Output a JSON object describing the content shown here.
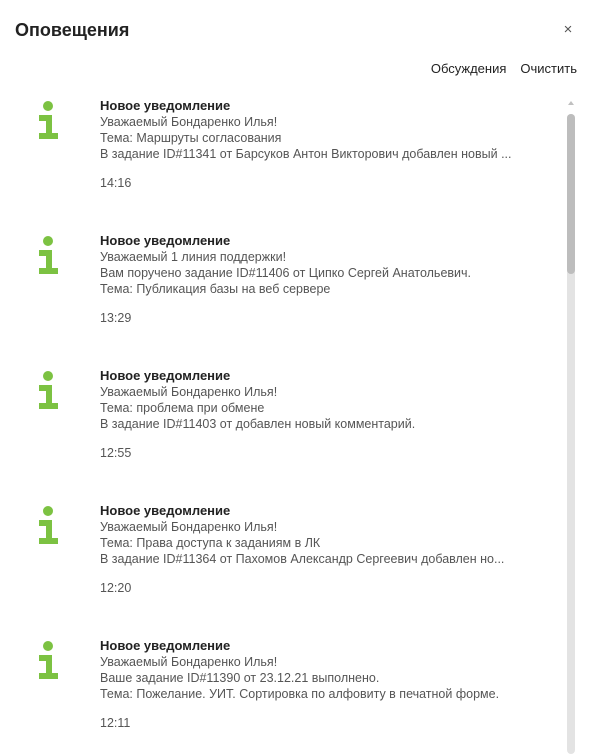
{
  "header": {
    "title": "Оповещения",
    "close_label": "×"
  },
  "toolbar": {
    "discussions_label": "Обсуждения",
    "clear_label": "Очистить"
  },
  "colors": {
    "accent_green": "#7cc242",
    "scrollbar_track": "#e3e3e3",
    "scrollbar_thumb": "#bdbdbd"
  },
  "notifications": [
    {
      "icon": "info-icon",
      "title": "Новое уведомление",
      "lines": [
        "Уважаемый Бондаренко Илья!",
        "Тема: Маршруты согласования",
        "В задание ID#11341 от Барсуков Антон Викторович добавлен новый ..."
      ],
      "time": "14:16"
    },
    {
      "icon": "info-icon",
      "title": "Новое уведомление",
      "lines": [
        "Уважаемый 1 линия поддержки!",
        "Вам поручено задание ID#11406 от Ципко Сергей Анатольевич.",
        "Тема: Публикация базы на веб сервере"
      ],
      "time": "13:29"
    },
    {
      "icon": "info-icon",
      "title": "Новое уведомление",
      "lines": [
        "Уважаемый Бондаренко Илья!",
        "Тема: проблема при обмене",
        "В задание ID#11403 от  добавлен новый комментарий."
      ],
      "time": "12:55"
    },
    {
      "icon": "info-icon",
      "title": "Новое уведомление",
      "lines": [
        "Уважаемый Бондаренко Илья!",
        "Тема: Права доступа к заданиям в ЛК",
        "В задание ID#11364 от Пахомов Александр Сергеевич добавлен но..."
      ],
      "time": "12:20"
    },
    {
      "icon": "info-icon",
      "title": "Новое уведомление",
      "lines": [
        "Уважаемый Бондаренко Илья!",
        "Ваше задание ID#11390 от 23.12.21 выполнено.",
        "Тема: Пожелание. УИТ. Сортировка по алфовиту в печатной форме."
      ],
      "time": "12:11"
    }
  ]
}
